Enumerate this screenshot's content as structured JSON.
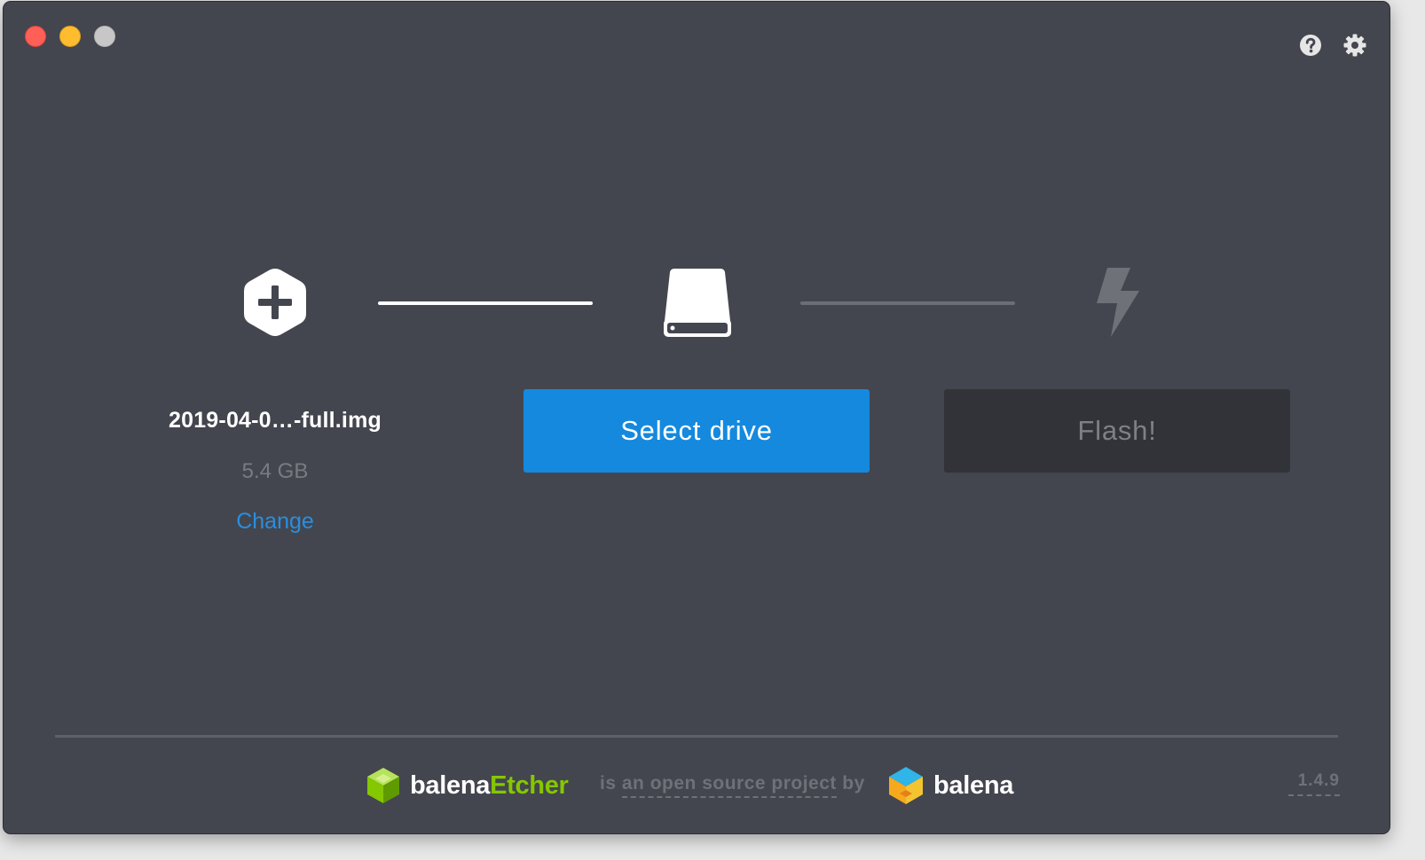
{
  "window": {
    "background": "#43464e"
  },
  "title_bar": {
    "controls": [
      "close",
      "minimize",
      "zoom"
    ],
    "icons": [
      "help-icon",
      "settings-icon"
    ]
  },
  "steps": {
    "image": {
      "icon": "add-image-hexagon-icon",
      "file_name": "2019-04-0…-full.img",
      "size": "5.4 GB",
      "change_label": "Change"
    },
    "drive": {
      "icon": "drive-icon",
      "button_label": "Select drive"
    },
    "flash": {
      "icon": "lightning-bolt-icon",
      "button_label": "Flash!"
    }
  },
  "footer": {
    "brand_etcher_part1": "balena",
    "brand_etcher_part2": "Etcher",
    "tagline_prefix": "is",
    "tagline_link": "an open source project",
    "tagline_suffix": "by",
    "brand_balena": "balena",
    "version": "1.4.9"
  },
  "colors": {
    "accent_blue": "#1589de",
    "link_blue": "#2a8ee0",
    "etcher_green": "#85c700",
    "flash_disabled_bg": "#323338"
  }
}
